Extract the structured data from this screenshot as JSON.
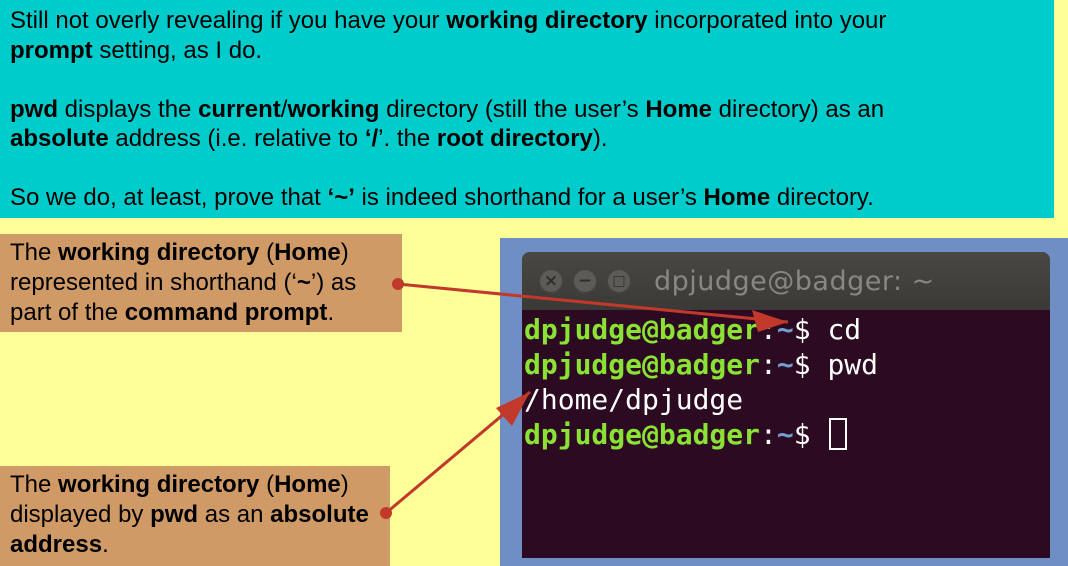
{
  "top_text": {
    "p1_pre": "Still not overly revealing if you have your ",
    "p1_b1": "working directory",
    "p1_mid": " incorporated into your ",
    "p1_b2": "prompt",
    "p1_post": " setting, as I do.",
    "p2_b1": "pwd",
    "p2_t1": "  displays  the ",
    "p2_b2": "current",
    "p2_t2": "/",
    "p2_b3": "working",
    "p2_t3": " directory (still the user’s ",
    "p2_b4": "Home",
    "p2_t4": " directory) as an ",
    "p2_b5": "absolute",
    "p2_t5": " address (i.e. relative to ",
    "p2_b6": "‘/",
    "p2_t6": "’. the ",
    "p2_b7": "root directory",
    "p2_t7": ").",
    "p3_pre": "So we do, at least, prove that ",
    "p3_b1": "‘~’",
    "p3_mid": " is indeed shorthand for a user’s ",
    "p3_b2": "Home",
    "p3_post": " directory."
  },
  "callout_top": {
    "t1": "The ",
    "b1": "working directory",
    "t2": " (",
    "b2": "Home",
    "t3": ") represented in shorthand (‘",
    "b3": "~",
    "t4": "’) as part of the ",
    "b4": "command prompt",
    "t5": "."
  },
  "callout_bottom": {
    "t1": "The ",
    "b1": "working directory",
    "t2": " (",
    "b2": "Home",
    "t3": ") displayed by ",
    "b3": "pwd",
    "t4": " as an ",
    "b4": "absolute address",
    "t5": "."
  },
  "terminal": {
    "title": "dpjudge@badger: ~",
    "user_host": "dpjudge@badger",
    "colon": ":",
    "path": "~",
    "prompt_sym": "$ ",
    "cmd1": "cd",
    "cmd2": "pwd",
    "output1": "/home/dpjudge",
    "buttons": {
      "close": "×",
      "minimize": "−",
      "maximize": "□"
    }
  },
  "colors": {
    "background": "#ffff99",
    "top_box": "#00cccc",
    "callout": "#d09a66",
    "arrow": "#c0392b",
    "terminal_bg": "#2c0a22",
    "user_green": "#8ae234",
    "path_blue": "#729fcf"
  }
}
